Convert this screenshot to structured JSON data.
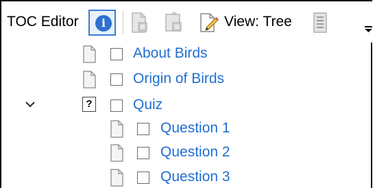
{
  "toolbar": {
    "title": "TOC Editor",
    "view_label": "View: Tree"
  },
  "tree": {
    "items": [
      {
        "label": "About Birds"
      },
      {
        "label": "Origin of Birds"
      },
      {
        "label": "Quiz"
      },
      {
        "label": "Question 1"
      },
      {
        "label": "Question 2"
      },
      {
        "label": "Question 3"
      }
    ],
    "quiz_icon": "?"
  },
  "colors": {
    "link": "#1f6fd1",
    "info": "#2f6fce",
    "selected_border": "#3a7fd0"
  },
  "icons": [
    "info-icon",
    "add-page-icon",
    "add-group-icon",
    "edit-page-icon",
    "list-icon",
    "overflow-icon",
    "chevron-down-icon",
    "page-icon",
    "quiz-icon"
  ]
}
